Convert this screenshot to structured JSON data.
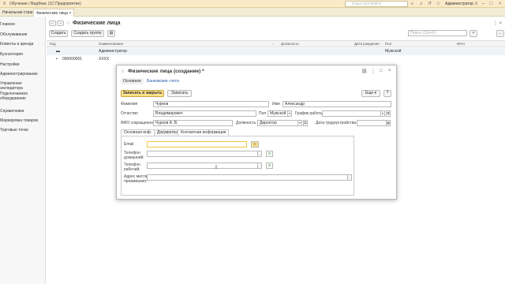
{
  "titlebar": {
    "title": "Обучение / ВидФакс (1С:Предприятие)",
    "search_placeholder": "Поиск Ctrl+Shift+F",
    "user": "Администратор"
  },
  "tabs": [
    "Начальная страница",
    "Физические лица"
  ],
  "sidebar": [
    "Главное",
    "Обслуживание",
    "Клиенты и аренда",
    "Бухгалтерия",
    "Настройки",
    "Администрирование",
    "Управление экспедитора",
    "Подключаемое оборудование",
    "Справочники",
    "Маркировка товаров",
    "Торговые точки"
  ],
  "list": {
    "title": "Физические лица",
    "create": "Создать",
    "create_group": "Создать группу",
    "search_placeholder": "Поиск (Ctrl+F)",
    "columns": [
      "Код",
      "Наименование",
      "Должность",
      "Дата рождения",
      "Пол",
      "ИНН"
    ],
    "rows": [
      {
        "code": "",
        "name": "Администратор",
        "pos": "",
        "bd": "",
        "sex": "Мужской",
        "inn": ""
      },
      {
        "code": "000000001",
        "name": "XXXX",
        "pos": "",
        "bd": "",
        "sex": "",
        "inn": ""
      }
    ]
  },
  "dialog": {
    "title": "Физические лица (создание) *",
    "tabs": [
      "Основное",
      "Банковские счета"
    ],
    "save_close": "Записать и закрыть",
    "save": "Записать",
    "more": "Еще",
    "help": "?",
    "fields": {
      "surname_label": "Фамилия",
      "surname": "Чурков",
      "name_label": "Имя",
      "name": "Александр",
      "patr_label": "Отчество",
      "patr": "Владимирович",
      "sex_label": "Пол",
      "sex": "Мужской",
      "schedule_label": "График работы",
      "short_label": "ФИО сокращенное",
      "short": "Чурков А. В.",
      "position_label": "Должность",
      "position": "Директор",
      "hire_label": "Дата трудоустройства"
    },
    "inner_tabs": [
      "Основная инф.",
      "Документы",
      "Контактная информация"
    ],
    "contacts": {
      "email_label": "Email",
      "home_label": "Телефон домашний:",
      "work_label": "Телефон рабочий:",
      "address_label": "Адрес места проживания:"
    }
  }
}
